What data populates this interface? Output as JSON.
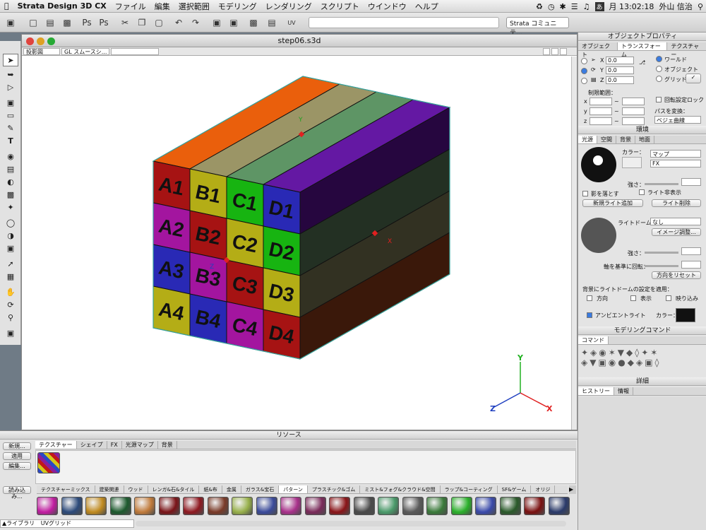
{
  "menubar": {
    "app": "Strata Design 3D CX",
    "items": [
      "ファイル",
      "編集",
      "選択範囲",
      "モデリング",
      "レンダリング",
      "スクリプト",
      "ウインドウ",
      "ヘルプ"
    ],
    "clock": "月 13:02:18",
    "user": "外山 信治",
    "input_mode": "あ"
  },
  "toolbar": {
    "community": "Strata コミュニテ..."
  },
  "document": {
    "title": "step06.s3d",
    "view_mode": "投影図",
    "render_mode": "GL スムースシ..."
  },
  "cube": {
    "top_colors": [
      "#ea5f0c",
      "#9b9566",
      "#5e9565",
      "#6418a3"
    ],
    "front_labels": [
      [
        "A1",
        "B1",
        "C1",
        "D1"
      ],
      [
        "A2",
        "B2",
        "C2",
        "D2"
      ],
      [
        "A3",
        "B3",
        "C3",
        "D3"
      ],
      [
        "A4",
        "B4",
        "C4",
        "D4"
      ]
    ],
    "front_colors": [
      [
        "#a61313",
        "#b4ad16",
        "#17b411",
        "#2929b5"
      ],
      [
        "#a3159f",
        "#a61313",
        "#b4ad16",
        "#17b411"
      ],
      [
        "#2929b5",
        "#a3159f",
        "#a61313",
        "#b4ad16"
      ],
      [
        "#b4ad16",
        "#2929b5",
        "#a3159f",
        "#a61313"
      ]
    ],
    "side_colors": [
      "#26063f",
      "#233023",
      "#323122",
      "#3a180a"
    ],
    "handle_labels": {
      "y_top": "Y",
      "x_side": "X",
      "z_front": "Z"
    }
  },
  "axes": {
    "x": "X",
    "y": "Y",
    "z": "Z"
  },
  "object_props": {
    "title": "オブジェクトプロパティ",
    "tabs": [
      "オブジェクト",
      "トランスフォーム",
      "テクスチャー"
    ],
    "coords": [
      {
        "axis": "X",
        "value": "0.0"
      },
      {
        "axis": "Y",
        "value": "0.0"
      },
      {
        "axis": "Z",
        "value": "0.0"
      }
    ],
    "modes": [
      "ワールド",
      "オブジェクト",
      "グリッド"
    ],
    "limit_label": "制限範囲：",
    "limit_axes": [
      "x",
      "y",
      "z"
    ],
    "rot_lock": "回転設定ロック",
    "path_convert": "パスを変換：",
    "path_type": "ベジェ曲線"
  },
  "environment": {
    "title": "環境",
    "tabs": [
      "光源",
      "空間",
      "背景",
      "地面"
    ],
    "color_label": "カラー：",
    "map_label": "マップ",
    "fx_label": "FX",
    "strength": "強さ：",
    "cast_shadow": "影を落とす",
    "hide_light": "ライト非表示",
    "add_light": "新規ライト追加",
    "delete_light": "ライト削除",
    "light_dome": "ライトドーム：",
    "light_dome_value": "なし",
    "image_adjust": "イメージ調整...",
    "strength2": "強さ：",
    "rotate_axis": "軸を基準に回転：",
    "reset_dir": "方向をリセット",
    "apply_bg": "背景にライトドームの設定を適用：",
    "apply_opts": [
      "方向",
      "表示",
      "映り込み"
    ],
    "ambient": "アンビエントライト",
    "ambient_color": "カラー："
  },
  "modeling": {
    "title": "モデリングコマンド",
    "tab": "コマンド"
  },
  "details": {
    "title": "詳細",
    "tabs": [
      "ヒストリー",
      "情報"
    ]
  },
  "resources": {
    "title": "リソース",
    "left_buttons": [
      "新規...",
      "適用",
      "編集..."
    ],
    "tabs": [
      "テクスチャー",
      "シェイプ",
      "FX",
      "光源マップ",
      "背景"
    ],
    "load": "読み込み...",
    "categories": [
      "テクスチャーミックス",
      "建築関連",
      "ウッド",
      "レンガ&石&タイル",
      "紙&布",
      "金属",
      "ガラス&宝石",
      "パターン",
      "プラスチック&ゴム",
      "ミスト&フォグ&クラウド&空間",
      "ラップ&コーティング",
      "SF&ゲーム",
      "オリジ"
    ],
    "library": "▲ライブラリ",
    "library_value": "UVグリッド",
    "swatch_colors": [
      "#c11da1",
      "#2c4a7a",
      "#c08a1f",
      "#1d5a2e",
      "#c07a3a",
      "#7a1418",
      "#8e1820",
      "#7a3a28",
      "#97b04a",
      "#3a4a9a",
      "#a8308a",
      "#7a2a5a",
      "#8a1418",
      "#4a4a4a",
      "#4a9a6a",
      "#5a5a5a",
      "#3a7a3a",
      "#2ab02a",
      "#3a4aaa",
      "#2a5a2a",
      "#7a1010",
      "#2a3a6a"
    ]
  }
}
